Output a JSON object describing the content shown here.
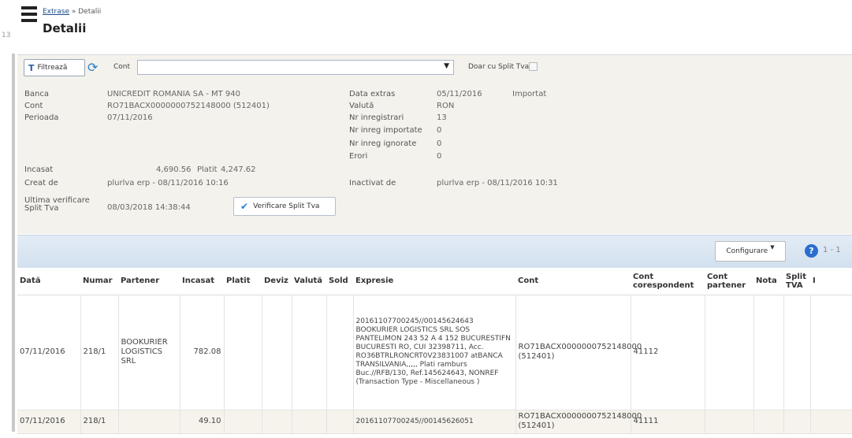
{
  "header": {
    "breadcrumb_link": "Extrase",
    "breadcrumb_sep": "»",
    "breadcrumb_current": "Detalii",
    "title": "Detalii",
    "left_number": "13"
  },
  "toolbar": {
    "filter_label": "Filtrează",
    "cont_label": "Cont",
    "cont_value": "",
    "split_label": "Doar cu Split Tva"
  },
  "details": {
    "banca_label": "Banca",
    "banca_value": "UNICREDIT ROMANIA SA - MT 940",
    "cont_label": "Cont",
    "cont_value": "RO71BACX0000000752148000 (512401)",
    "perioada_label": "Perioada",
    "perioada_value": "07/11/2016",
    "incasat_label": "Incasat",
    "incasat_value": "4,690.56",
    "platit_label": "Platit",
    "platit_value": "4,247.62",
    "creat_label": "Creat de",
    "creat_value": "plurlva erp - 08/11/2016 10:16",
    "ultima_label_1": "Ultima verificare",
    "ultima_label_2": "Split Tva",
    "ultima_value": "08/03/2018 14:38:44",
    "verif_button": "Verificare Split Tva",
    "data_extras_label": "Data extras",
    "data_extras_value": "05/11/2016",
    "status": "Importat",
    "valuta_label": "Valută",
    "valuta_value": "RON",
    "nr_inreg_label": "Nr inregistrari",
    "nr_inreg_value": "13",
    "nr_importate_label": "Nr inreg importate",
    "nr_importate_value": "0",
    "nr_ignorate_label": "Nr inreg ignorate",
    "nr_ignorate_value": "0",
    "erori_label": "Erori",
    "erori_value": "0",
    "inactivat_label": "Inactivat de",
    "inactivat_value": "plurlva erp - 08/11/2016 10:31"
  },
  "grid_bar": {
    "config_label": "Configurare",
    "pager_text": "1 - 1"
  },
  "grid": {
    "columns": [
      "Dată",
      "Numar",
      "Partener",
      "Incasat",
      "Platit",
      "Deviz",
      "Valută",
      "Sold",
      "Expresie",
      "Cont",
      "Cont corespondent",
      "Cont partener",
      "Nota",
      "Split TVA",
      "I"
    ],
    "rows": [
      {
        "data": "07/11/2016",
        "numar": "218/1",
        "partener": "BOOKURIER LOGISTICS SRL",
        "incasat": "782.08",
        "platit": "",
        "deviz": "",
        "valuta": "",
        "sold": "",
        "expresie": "20161107700245//00145624643 BOOKURIER LOGISTICS SRL SOS PANTELIMON 243 52 A 4 152 BUCURESTIFN BUCURESTI RO, CUI 32398711, Acc. RO36BTRLRONCRT0V23831007 atBANCA TRANSILVANIA,,,,, Plati ramburs Buc.//RFB/130, Ref.145624643, NONREF (Transaction Type - Miscellaneous )",
        "cont": "RO71BACX0000000752148000 (512401)",
        "cont_corespondent": "41112",
        "cont_partener": "",
        "nota": "",
        "split": ""
      },
      {
        "data": "07/11/2016",
        "numar": "218/1",
        "partener": "",
        "incasat": "49.10",
        "platit": "",
        "deviz": "",
        "valuta": "",
        "sold": "",
        "expresie": "20161107700245//00145626051",
        "cont": "RO71BACX0000000752148000 (512401)",
        "cont_corespondent": "41111",
        "cont_partener": "",
        "nota": "",
        "split": ""
      }
    ]
  }
}
